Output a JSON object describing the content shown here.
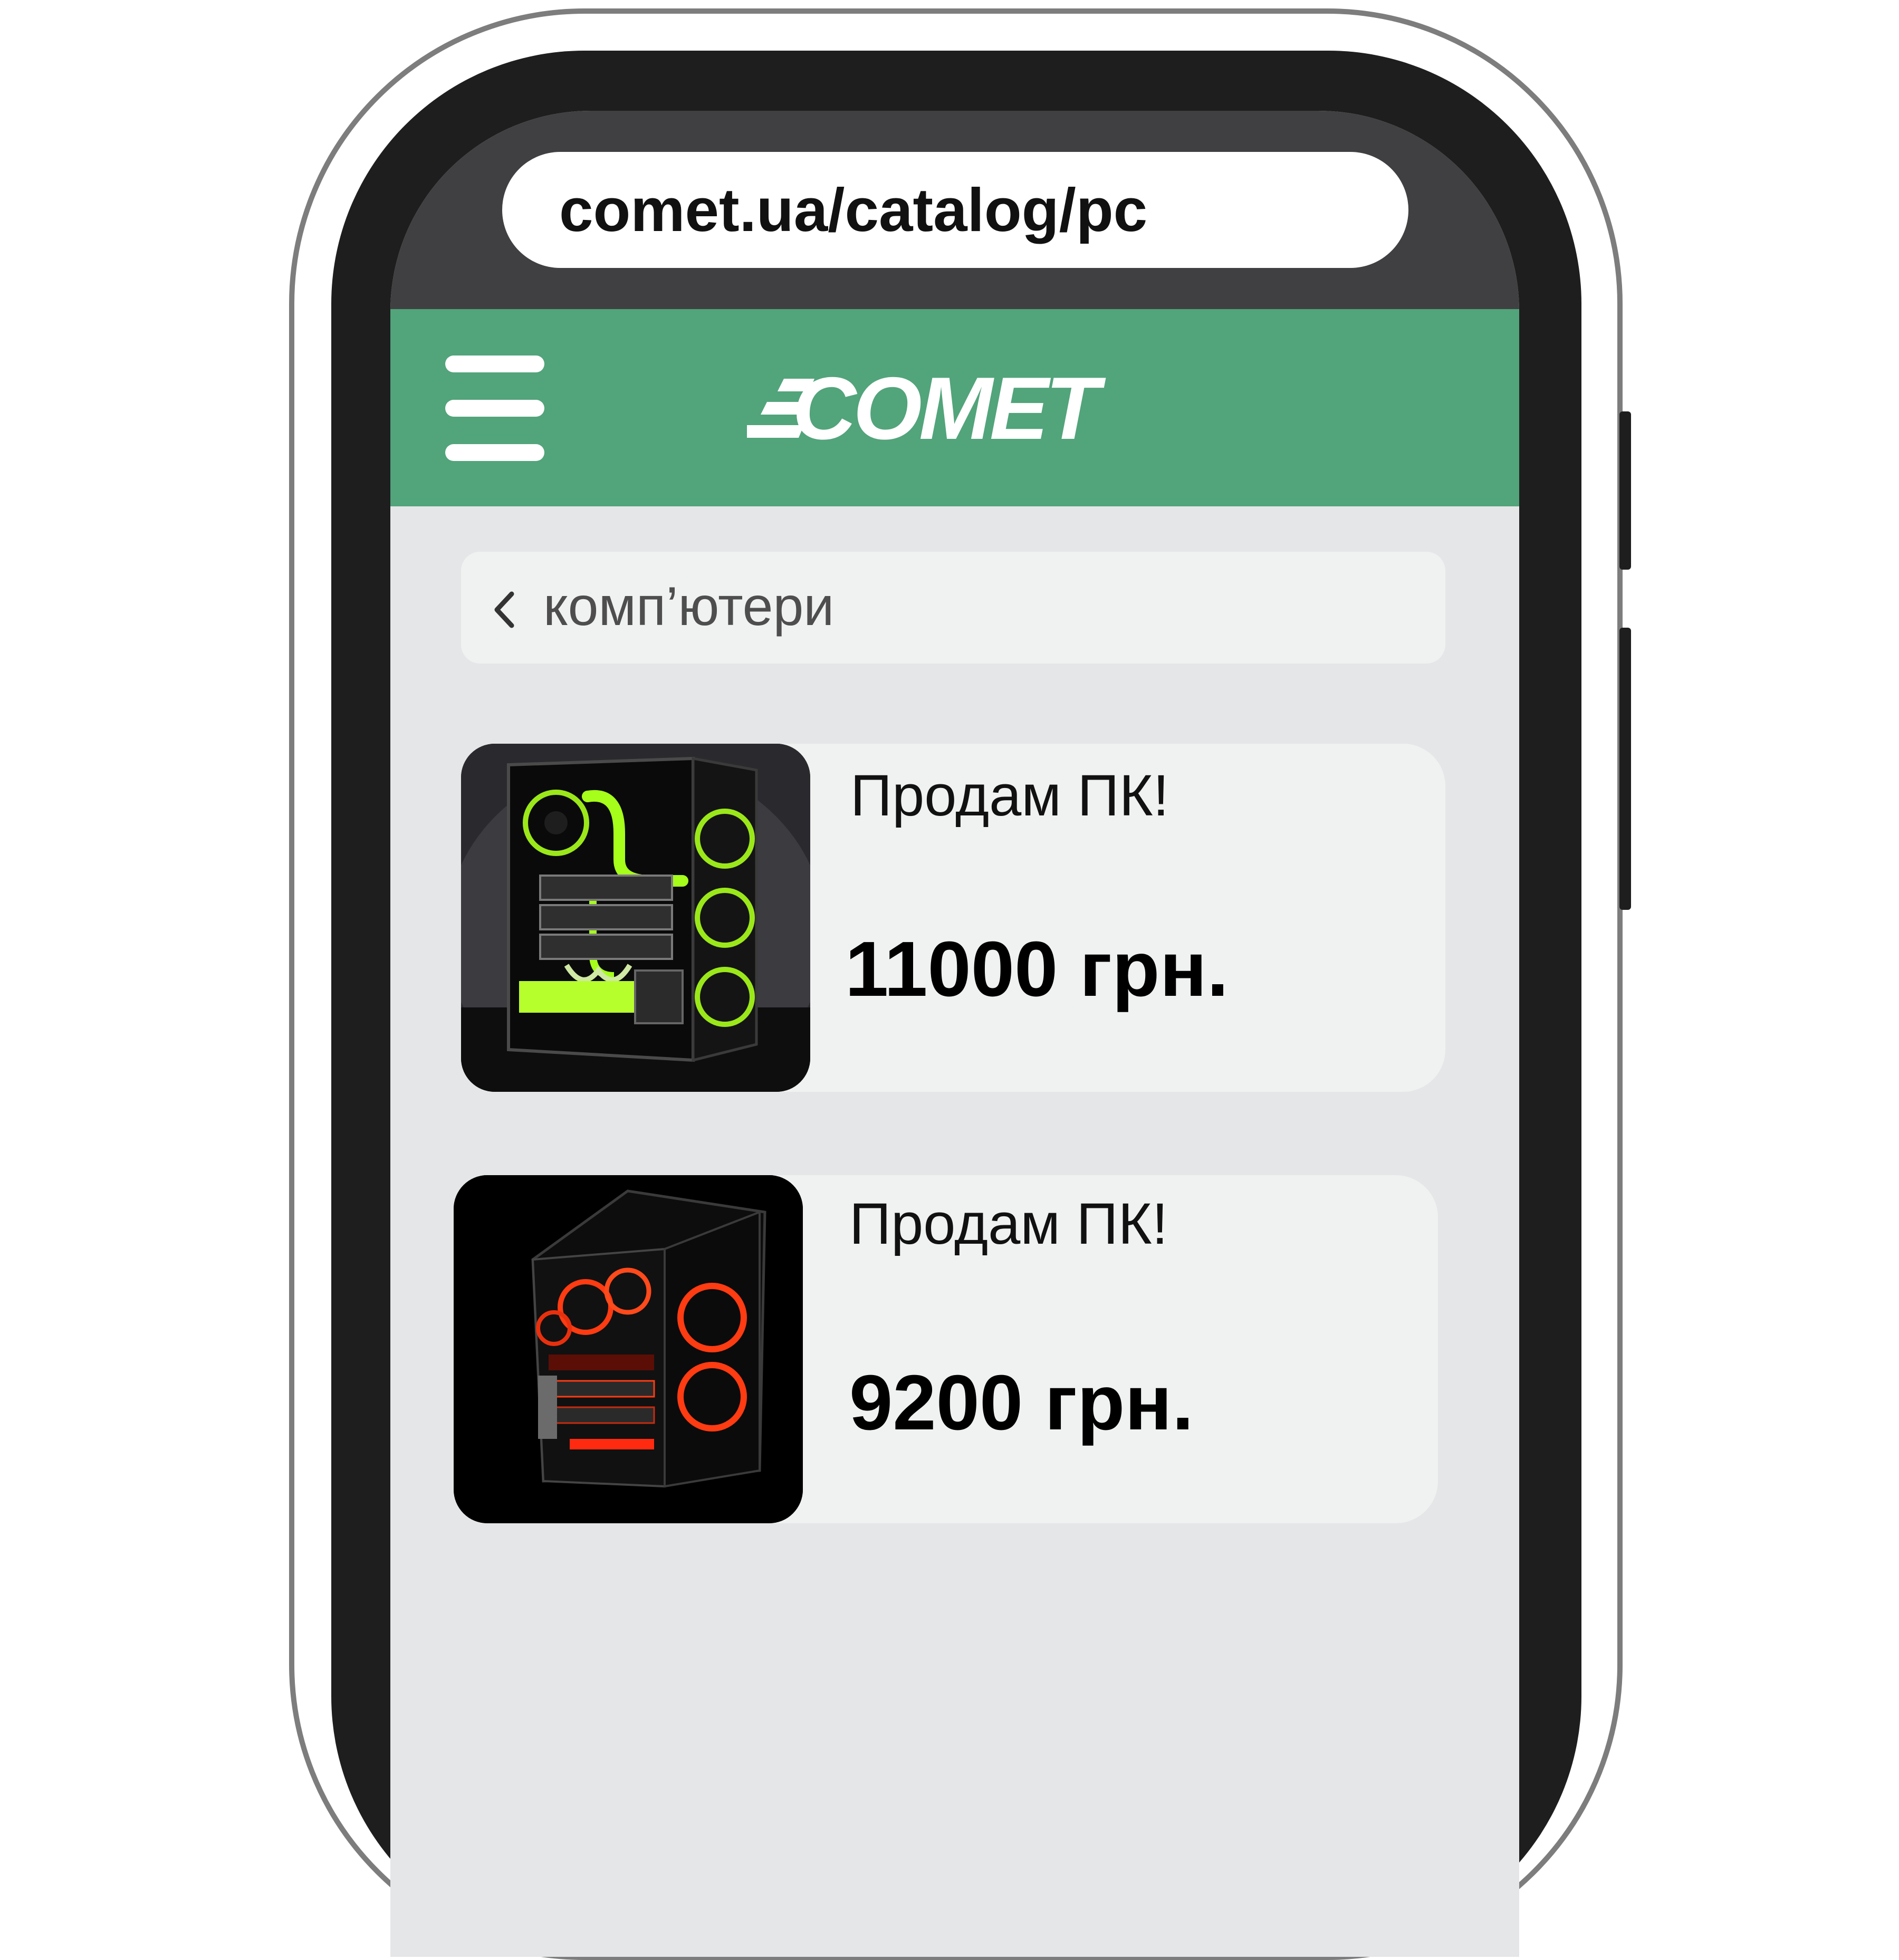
{
  "browser": {
    "url": "comet.ua/catalog/pc"
  },
  "header": {
    "logo_text": "COMET",
    "brand_color": "#52a47b",
    "menu_icon": "hamburger-menu-icon"
  },
  "breadcrumb": {
    "icon": "chevron-left-icon",
    "label": "комп’ютери"
  },
  "listings": [
    {
      "title": "Продам ПК!",
      "price": "11000 грн.",
      "image": "gaming-pc-green-water-cooling"
    },
    {
      "title": "Продам ПК!",
      "price": "9200 грн.",
      "image": "gaming-pc-red-rgb-fans"
    }
  ]
}
